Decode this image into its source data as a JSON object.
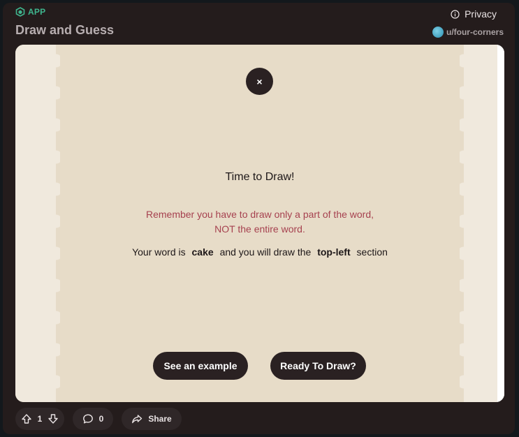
{
  "header": {
    "app_label": "APP",
    "title": "Draw and Guess",
    "privacy_label": "Privacy",
    "username": "u/four-corners"
  },
  "card": {
    "close_label": "×",
    "heading": "Time to Draw!",
    "note_line1": "Remember you have to draw only a part of the word,",
    "note_line2": "NOT the entire word.",
    "word_prefix": "Your word is",
    "word": "cake",
    "word_middle": "and you will draw the",
    "section": "top-left",
    "word_suffix": "section",
    "example_button": "See an example",
    "ready_button": "Ready To Draw?"
  },
  "actions": {
    "vote_count": "1",
    "comment_count": "0",
    "share_label": "Share"
  },
  "colors": {
    "app_accent": "#3fb58e",
    "card_bg": "#e7dcc8",
    "note_red": "#a6414f",
    "button_dark": "#2a2122"
  }
}
